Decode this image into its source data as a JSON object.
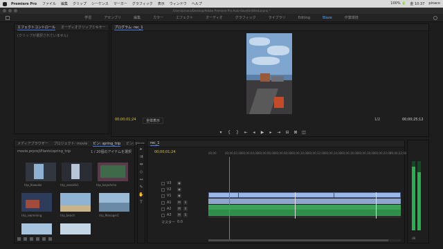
{
  "menubar": {
    "app": "Premiere Pro",
    "items": [
      "ファイル",
      "編集",
      "クリップ",
      "シーケンス",
      "マーカー",
      "グラフィック",
      "表示",
      "ウィンドウ",
      "ヘルプ"
    ],
    "right": [
      "100% 🔋",
      "金 10:37",
      "pinaco"
    ]
  },
  "titlebar": {
    "path": "/Users/pinaco/Desktop/Adobe Premiere Pro Auto-Save/Untitled.prproj *"
  },
  "workspaces": [
    "学習",
    "アセンブリ",
    "編集",
    "カラー",
    "エフェクト",
    "オーディオ",
    "グラフィック",
    "ライブラリ",
    "Editing",
    "Blaze",
    "作業環境"
  ],
  "workspace_active": 9,
  "fx": {
    "tabs": [
      "エフェクトコントロール",
      "オーディオクリップミキサー"
    ],
    "empty_msg": "(クリップが選択されていません)"
  },
  "program": {
    "tab": "プログラム: rec_1",
    "timecode_left": "00;00;01;24",
    "fit": "全体表示",
    "quality": "1/2",
    "timecode_right": "00;00;25;12"
  },
  "project": {
    "tabs": [
      "メディアブラウザー",
      "プロジェクト: movie",
      "ビン: spring_trip",
      "ビン: blaze"
    ],
    "path": "movie.prproj\\Plants\\spring_trip",
    "selection": "1 / 20個のアイテムを選択",
    "clips": [
      "trip_Kawaike",
      "trip_seaside1",
      "trip_kaiyohcho",
      "trip_swimming",
      "trip_beach",
      "trip_Manager1",
      "trip_Yokohama",
      "trip_eagle"
    ]
  },
  "timeline": {
    "tab": "rec_1",
    "timecode": "00;00;01;24",
    "ruler": [
      "00;00",
      "00;00;02;00",
      "00;00;04;00",
      "00;00;06;00",
      "00;00;08;00",
      "00;00;10;00",
      "00;00;12;00",
      "00;00;14;00",
      "00;00;16;00",
      "00;00;18;00",
      "00;00;20;00",
      "00;00;22;00"
    ],
    "tracks": [
      {
        "name": "V3"
      },
      {
        "name": "V2"
      },
      {
        "name": "V1"
      },
      {
        "name": "A1"
      },
      {
        "name": "A2"
      },
      {
        "name": "A3"
      }
    ],
    "master": "マスター",
    "master_val": "0.0"
  },
  "meters": {
    "levels": [
      0.92,
      0.84
    ],
    "scale": "dB"
  }
}
